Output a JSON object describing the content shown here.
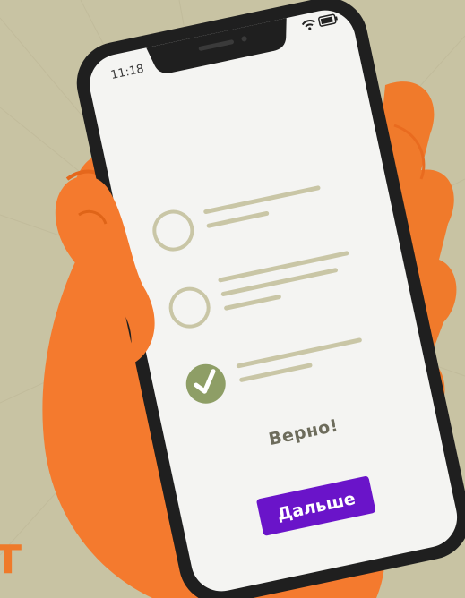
{
  "status_bar": {
    "time": "11:18",
    "icons": [
      "wifi-icon",
      "battery-icon"
    ]
  },
  "quiz": {
    "options": [
      {
        "state": "unselected"
      },
      {
        "state": "unselected"
      },
      {
        "state": "correct",
        "icon": "checkmark-icon"
      }
    ],
    "result_text": "Верно!",
    "next_button_label": "Дальше"
  },
  "brand": {
    "partial_letter": "T"
  },
  "colors": {
    "background": "#c8c3a3",
    "hand": "#f47a2e",
    "phone_body": "#1f1f1f",
    "screen": "#f4f4f2",
    "option_outline": "#c9c6a6",
    "correct_fill": "#8e9e66",
    "button": "#6a14c9",
    "text_result": "#6d6c5c"
  }
}
